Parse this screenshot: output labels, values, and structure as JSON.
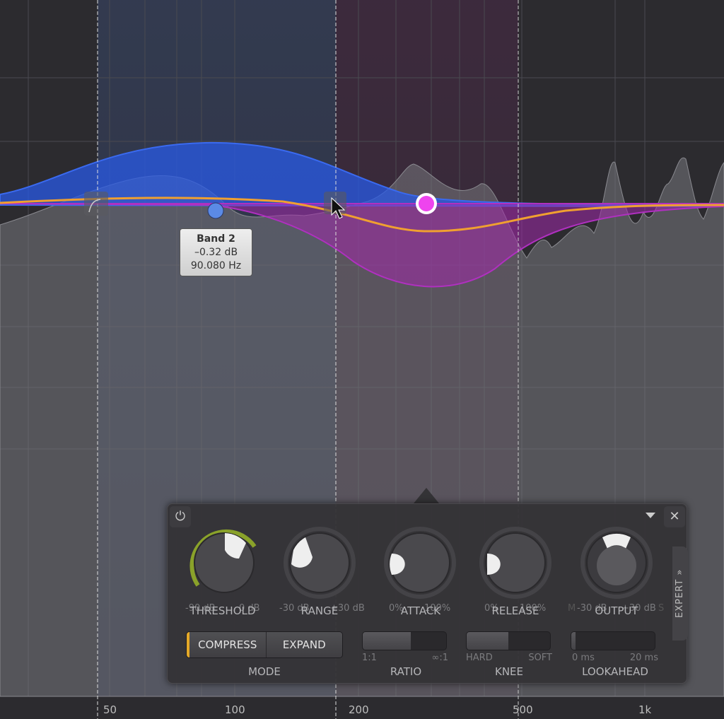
{
  "graph": {
    "freq_labels": [
      "50",
      "100",
      "200",
      "500",
      "1k"
    ],
    "band_colors": {
      "band1": "#2f5ee0",
      "band2": "#c02ccc",
      "crossover_curve": "#f0a030"
    }
  },
  "tooltip": {
    "title": "Band 2",
    "gain": "–0.32 dB",
    "freq": "90.080 Hz"
  },
  "panel": {
    "power_icon": "power-icon",
    "close_label": "✕",
    "expert_label": "EXPERT »",
    "knobs": [
      {
        "name": "THRESHOLD",
        "min": "-90 dB",
        "max": "0 dB"
      },
      {
        "name": "RANGE",
        "min": "-30 dB",
        "max": "+30 dB"
      },
      {
        "name": "ATTACK",
        "min": "0%",
        "max": "100%"
      },
      {
        "name": "RELEASE",
        "min": "0%",
        "max": "100%"
      },
      {
        "name": "OUTPUT",
        "min": "-30 dB",
        "max": "+30 dB",
        "left_mark": "M",
        "right_mark": "S"
      }
    ],
    "mode": {
      "label": "MODE",
      "options": [
        "COMPRESS",
        "EXPAND"
      ],
      "selected": "COMPRESS"
    },
    "ratio": {
      "label": "RATIO",
      "min": "1:1",
      "max": "∞:1",
      "value_fraction": 0.58
    },
    "knee": {
      "label": "KNEE",
      "min": "HARD",
      "max": "SOFT",
      "value_fraction": 0.5
    },
    "lookahead": {
      "label": "LOOKAHEAD",
      "min": "0 ms",
      "max": "20 ms",
      "value_fraction": 0.05
    }
  }
}
